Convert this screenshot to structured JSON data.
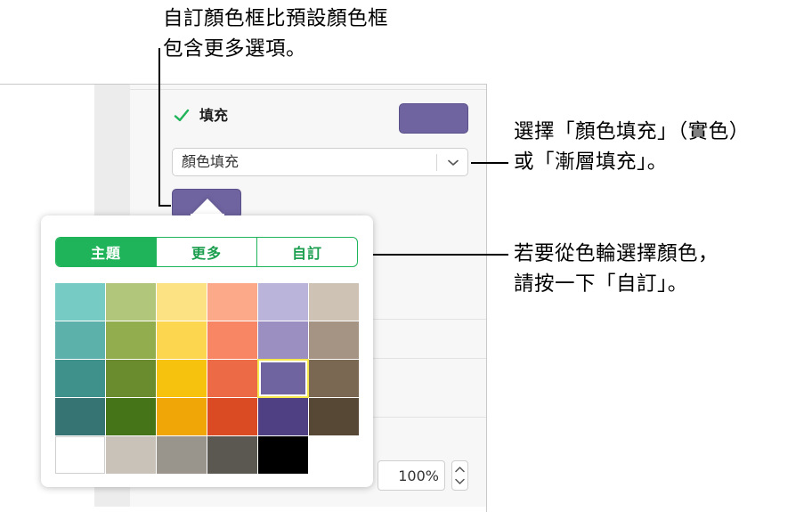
{
  "callouts": {
    "top": {
      "line1": "自訂顏色框比預設顏色框",
      "line2": "包含更多選項。"
    },
    "right_top": {
      "line1": "選擇「顏色填充」（實色）",
      "line2": "或「漸層填充」。"
    },
    "right_bottom": {
      "line1": "若要從色輪選擇顏色，",
      "line2": "請按一下「自訂」。"
    }
  },
  "fill_panel": {
    "fill_label": "填充",
    "fill_checked": true,
    "fill_color": "#6f64a0",
    "fill_type_value": "顏色填充"
  },
  "popover": {
    "tabs": [
      {
        "label": "主題",
        "active": true
      },
      {
        "label": "更多",
        "active": false
      },
      {
        "label": "自訂",
        "active": false
      }
    ],
    "swatches": [
      [
        "#76cbc4",
        "#b2c67b",
        "#fde283",
        "#fca98a",
        "#bab3da",
        "#cdc2b3"
      ],
      [
        "#5cb2ab",
        "#91ad4d",
        "#fdd64f",
        "#f88665",
        "#9a8fc0",
        "#a59483"
      ],
      [
        "#3f928c",
        "#6a8b2e",
        "#f6c20e",
        "#ed6a47",
        "#6f64a0",
        "#7a6853"
      ],
      [
        "#367474",
        "#457318",
        "#f1a608",
        "#da4b24",
        "#4f4084",
        "#574836"
      ],
      [
        "#ffffff",
        "#c8c2b9",
        "#99958c",
        "#5b5851",
        "#000000"
      ]
    ],
    "selected_swatch": {
      "row": 2,
      "col": 4
    }
  },
  "opacity": {
    "value": "100%"
  },
  "colors": {
    "accent": "#1fb35a",
    "selected_outline": "#f4e64c"
  }
}
